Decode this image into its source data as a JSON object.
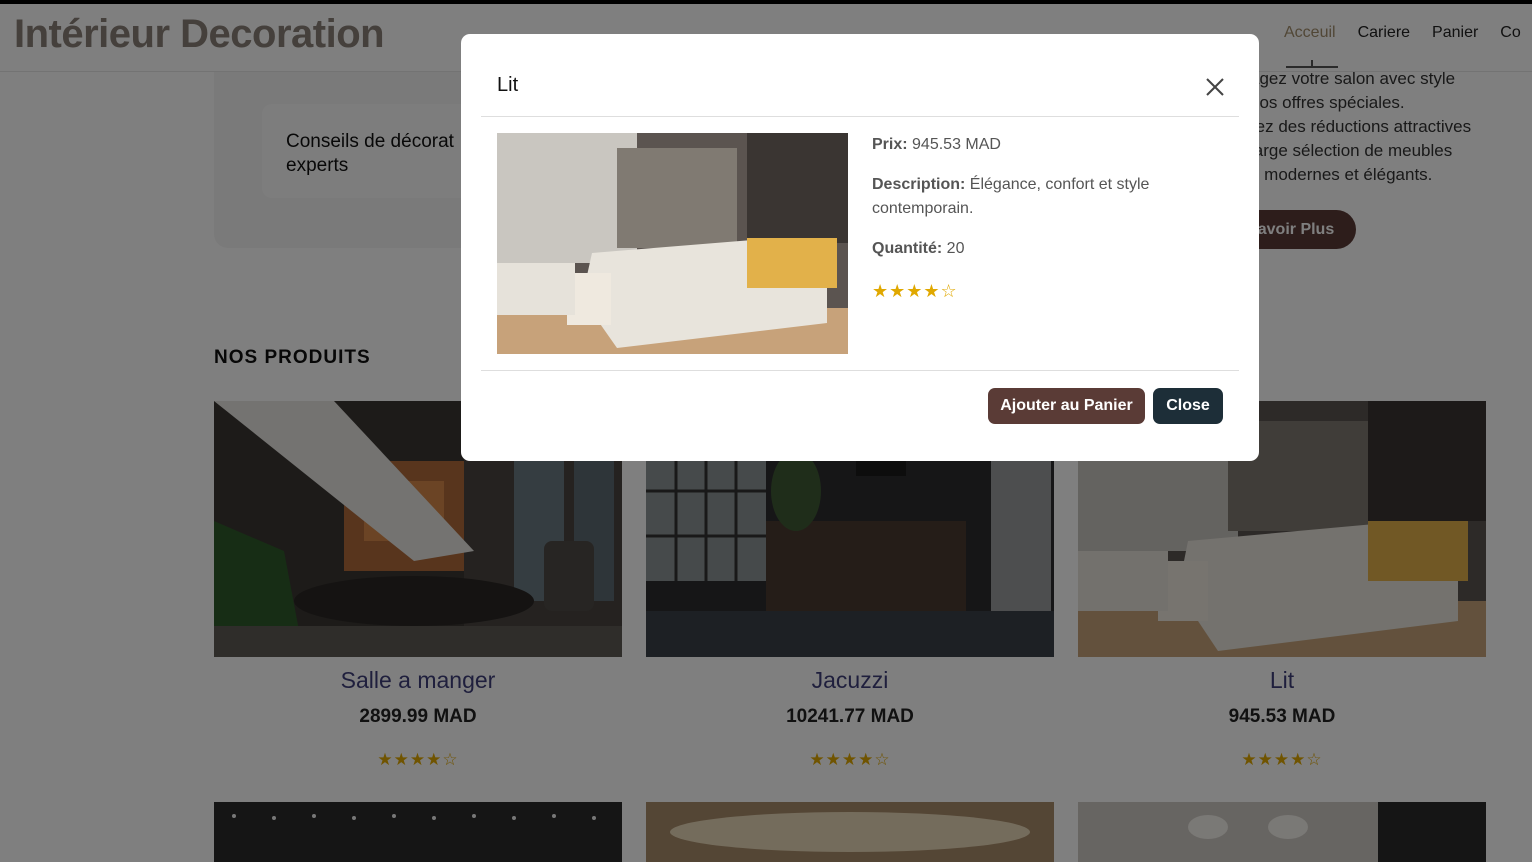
{
  "brand": {
    "name": "Intérieur Decoration"
  },
  "nav": {
    "items": [
      "Acceuil",
      "Cariere",
      "Panier",
      "Co"
    ],
    "active_index": 0
  },
  "feature": {
    "text_line1": "Conseils de décorat",
    "text_line2": "experts"
  },
  "promo": {
    "lines": [
      "agez votre salon avec style",
      "nos offres spéciales.",
      "rez des réductions attractives",
      "large sélection de meubles",
      "n modernes et élégants."
    ],
    "button_label": "avoir Plus"
  },
  "section": {
    "title": "NOS PRODUITS"
  },
  "products": [
    {
      "name": "Salle a manger",
      "price": "2899.99 MAD",
      "stars": "★★★★☆"
    },
    {
      "name": "Jacuzzi",
      "price": "10241.77 MAD",
      "stars": "★★★★☆"
    },
    {
      "name": "Lit",
      "price": "945.53 MAD",
      "stars": "★★★★☆"
    }
  ],
  "modal": {
    "title": "Lit",
    "price_label": "Prix:",
    "price_value": " 945.53 MAD",
    "description_label": "Description:",
    "description_value": " Élégance, confort et style contemporain.",
    "quantity_label": "Quantité:",
    "quantity_value": " 20",
    "stars": "★★★★☆",
    "add_button": "Ajouter au Panier",
    "close_button": "Close"
  },
  "colors": {
    "brand_brown": "#5a3b36",
    "dark_navy": "#1d2e38",
    "star_gold": "#e0a800",
    "product_title": "#3f3f7a"
  }
}
